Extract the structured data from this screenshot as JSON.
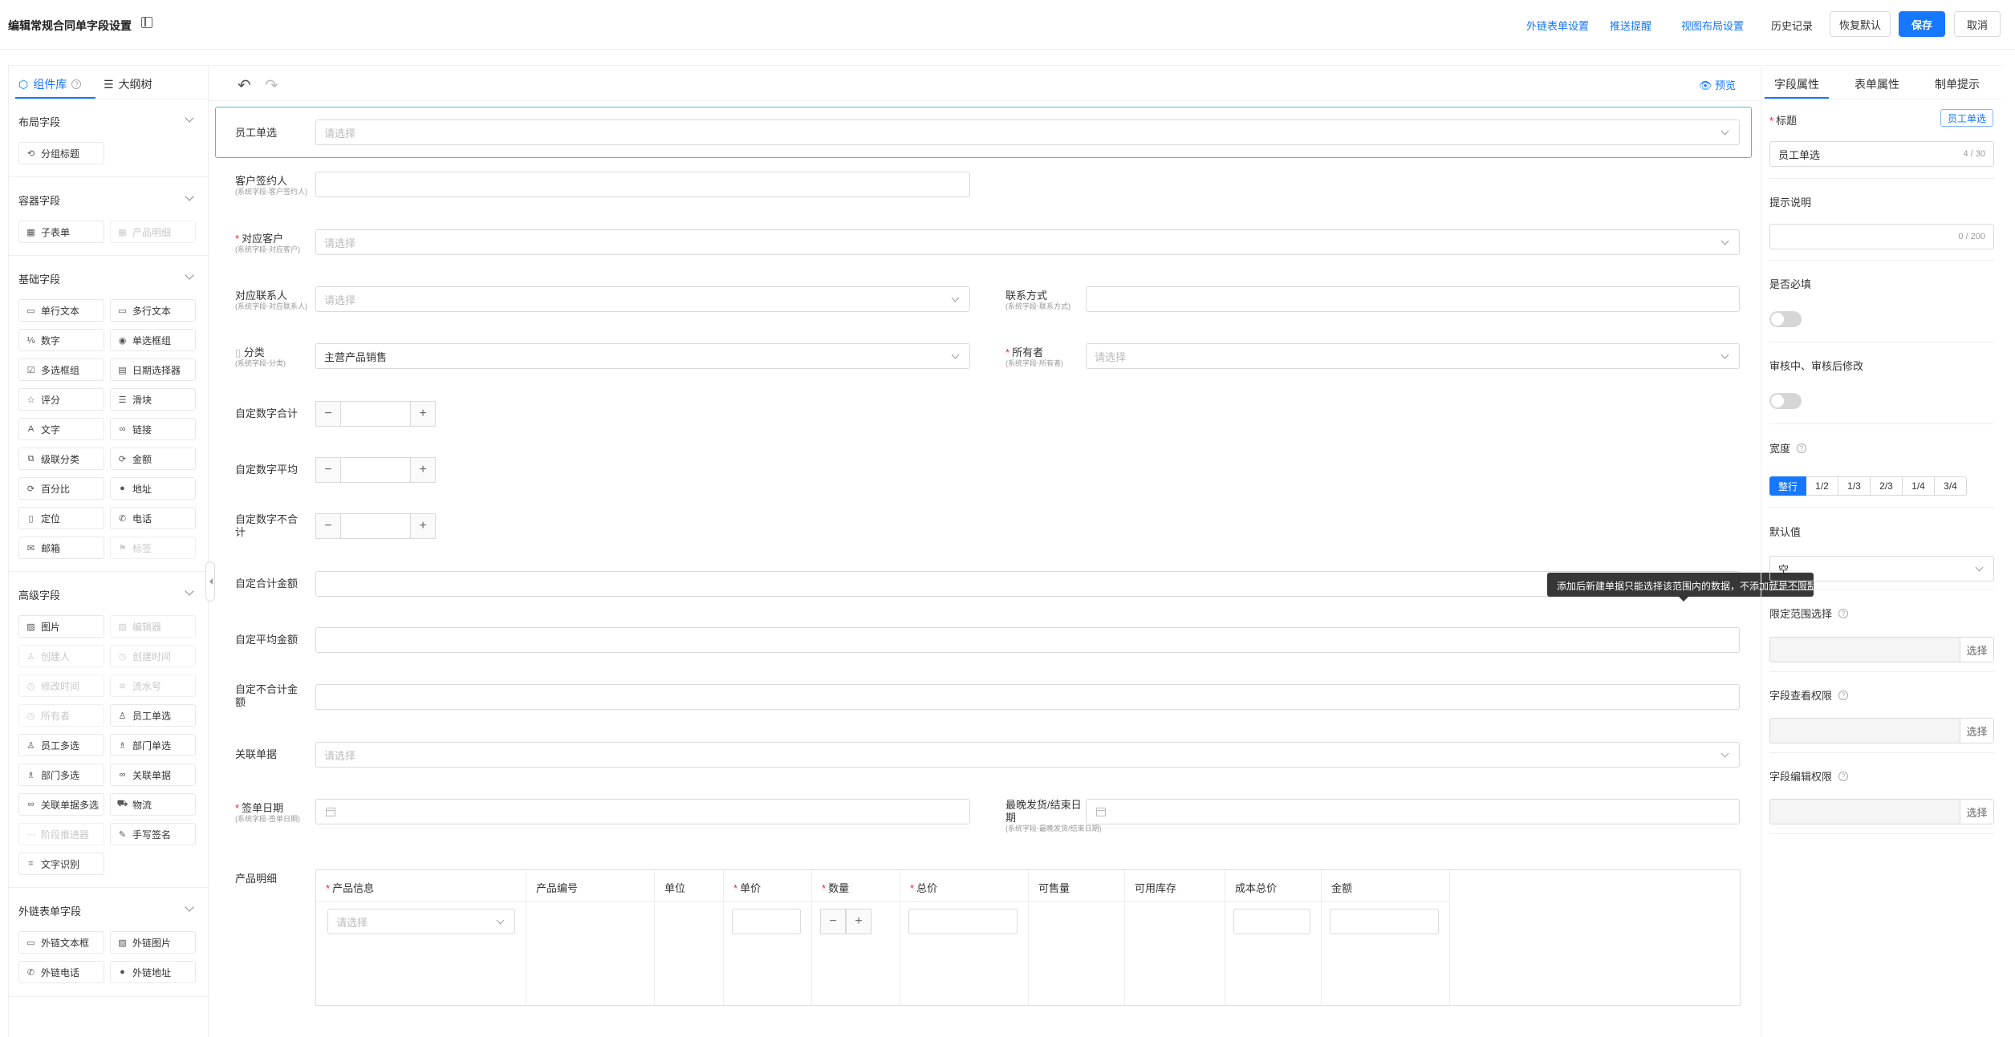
{
  "header": {
    "title": "编辑常规合同单字段设置",
    "links": [
      "外链表单设置",
      "推送提醒",
      "视图布局设置"
    ],
    "history": "历史记录",
    "reset": "恢复默认",
    "save": "保存",
    "cancel": "取消"
  },
  "left": {
    "tabs": [
      "组件库",
      "大纲树"
    ],
    "groups": {
      "layout": {
        "title": "布局字段",
        "items": [
          "分组标题"
        ]
      },
      "container": {
        "title": "容器字段",
        "items": [
          "子表单",
          "产品明细"
        ]
      },
      "basic": {
        "title": "基础字段",
        "items": [
          "单行文本",
          "多行文本",
          "数字",
          "单选框组",
          "多选框组",
          "日期选择器",
          "评分",
          "滑块",
          "文字",
          "链接",
          "级联分类",
          "金额",
          "百分比",
          "地址",
          "定位",
          "电话",
          "邮箱",
          "标签"
        ]
      },
      "advanced": {
        "title": "高级字段",
        "items": [
          "图片",
          "编辑器",
          "创建人",
          "创建时间",
          "修改时间",
          "流水号",
          "所有者",
          "员工单选",
          "员工多选",
          "部门单选",
          "部门多选",
          "关联单据",
          "关联单据多选",
          "物流",
          "阶段推进器",
          "手写签名",
          "文字识别"
        ]
      },
      "external": {
        "title": "外链表单字段",
        "items": [
          "外链文本框",
          "外链图片",
          "外链电话",
          "外链地址"
        ]
      }
    }
  },
  "canvas": {
    "preview": "预览",
    "placeholder": "请选择",
    "fields": {
      "employee": "员工单选",
      "signer": "客户签约人",
      "signer_sub": "(系统字段-客户签约人)",
      "customer": "对应客户",
      "customer_sub": "(系统字段-对应客户)",
      "contact": "对应联系人",
      "contact_sub": "(系统字段-对应联系人)",
      "phone": "联系方式",
      "phone_sub": "(系统字段-联系方式)",
      "category": "分类",
      "category_sub": "(系统字段-分类)",
      "category_value": "主营产品销售",
      "owner": "所有者",
      "owner_sub": "(系统字段-所有者)",
      "num_sum": "自定数字合计",
      "num_avg": "自定数字平均",
      "num_nosum": "自定数字不合计",
      "amt_sum": "自定合计金额",
      "amt_avg": "自定平均金额",
      "amt_nosum": "自定不合计金额",
      "related": "关联单据",
      "sign_date": "签单日期",
      "sign_date_sub": "(系统字段-签单日期)",
      "end_date": "最晚发货/结束日期",
      "end_date_sub": "(系统字段-最晚发货/结束日期)",
      "products": "产品明细"
    },
    "product_table": {
      "headers": [
        "产品信息",
        "产品编号",
        "单位",
        "单价",
        "数量",
        "总价",
        "可售量",
        "可用库存",
        "成本总价",
        "金额"
      ],
      "required": [
        true,
        false,
        false,
        true,
        true,
        true,
        false,
        false,
        false,
        false
      ]
    }
  },
  "tooltip": "添加后新建单据只能选择该范围内的数据，不添加就是不限制范围。",
  "right": {
    "tabs": [
      "字段属性",
      "表单属性",
      "制单提示"
    ],
    "title_label": "标题",
    "title_badge": "员工单选",
    "title_value": "员工单选",
    "title_count": "4 / 30",
    "hint_label": "提示说明",
    "hint_count": "0 / 200",
    "required_label": "是否必填",
    "edit_label": "审核中、审核后修改",
    "width_label": "宽度",
    "width_options": [
      "整行",
      "1/2",
      "1/3",
      "2/3",
      "1/4",
      "3/4"
    ],
    "default_label": "默认值",
    "default_value": "空",
    "range_label": "限定范围选择",
    "view_label": "字段查看权限",
    "edit_perm_label": "字段编辑权限",
    "pick": "选择"
  }
}
